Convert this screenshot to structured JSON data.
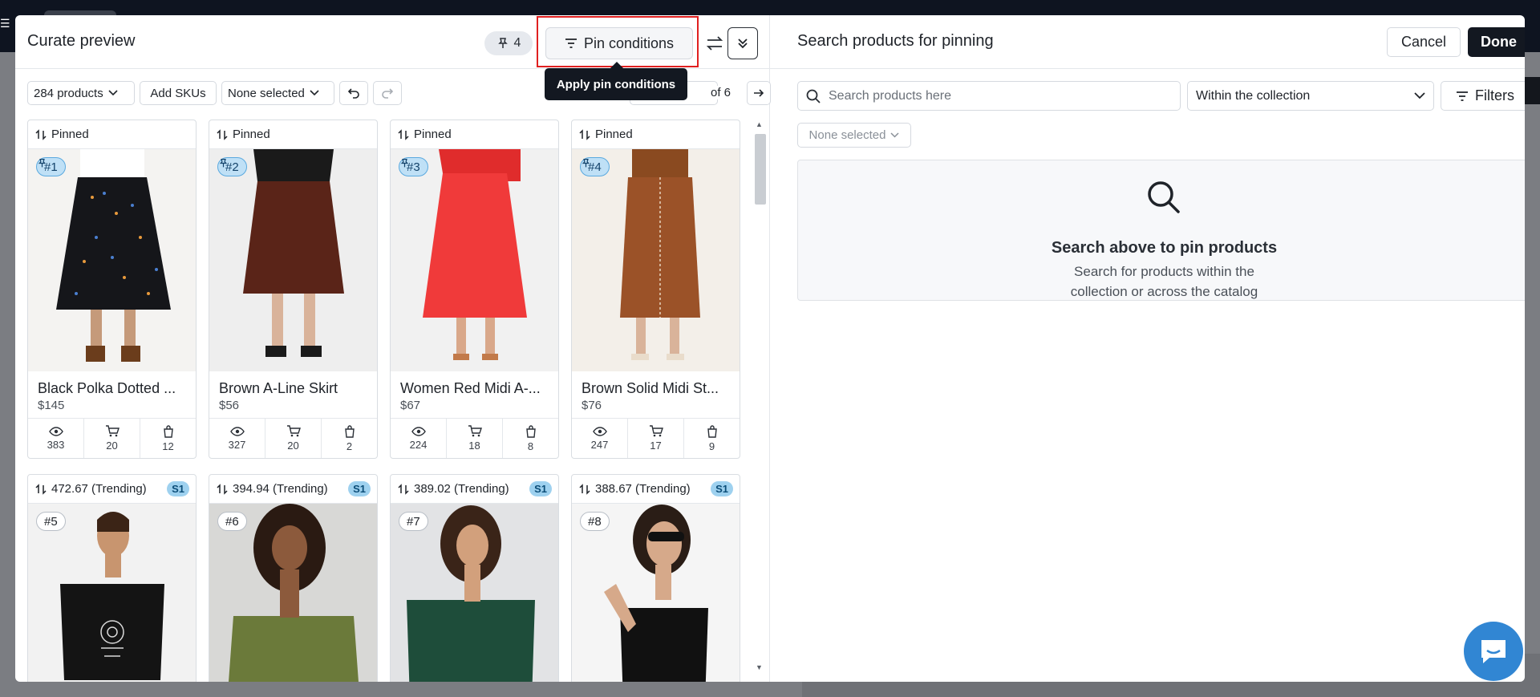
{
  "left": {
    "title": "Curate preview",
    "pin_count": "4",
    "pin_conditions_label": "Pin conditions",
    "tooltip": "Apply pin conditions",
    "toolbar": {
      "products_count": "284 products",
      "add_skus": "Add SKUs",
      "selection": "None selected",
      "pager_of": "of 6"
    },
    "products": [
      {
        "status": "Pinned",
        "rank": "#1",
        "pinned": true,
        "name": "Black Polka Dotted ...",
        "price": "$145",
        "views": "383",
        "carts": "20",
        "orders": "12"
      },
      {
        "status": "Pinned",
        "rank": "#2",
        "pinned": true,
        "name": "Brown A-Line Skirt",
        "price": "$56",
        "views": "327",
        "carts": "20",
        "orders": "2"
      },
      {
        "status": "Pinned",
        "rank": "#3",
        "pinned": true,
        "name": "Women Red Midi A-...",
        "price": "$67",
        "views": "224",
        "carts": "18",
        "orders": "8"
      },
      {
        "status": "Pinned",
        "rank": "#4",
        "pinned": true,
        "name": "Brown Solid Midi St...",
        "price": "$76",
        "views": "247",
        "carts": "17",
        "orders": "9"
      },
      {
        "status": "472.67 (Trending)",
        "badge": "S1",
        "rank": "#5",
        "pinned": false
      },
      {
        "status": "394.94 (Trending)",
        "badge": "S1",
        "rank": "#6",
        "pinned": false
      },
      {
        "status": "389.02 (Trending)",
        "badge": "S1",
        "rank": "#7",
        "pinned": false
      },
      {
        "status": "388.67 (Trending)",
        "badge": "S1",
        "rank": "#8",
        "pinned": false
      }
    ]
  },
  "right": {
    "title": "Search products for pinning",
    "cancel": "Cancel",
    "done": "Done",
    "search_placeholder": "Search products here",
    "scope": "Within the collection",
    "filters": "Filters",
    "selection": "None selected",
    "empty_title": "Search above to pin products",
    "empty_sub_1": "Search for products within the",
    "empty_sub_2": "collection or across the catalog"
  },
  "colors": {
    "accent_dark": "#131821",
    "pin_badge": "#bfe0f6",
    "highlight": "#e02020",
    "chat": "#3186d3"
  }
}
